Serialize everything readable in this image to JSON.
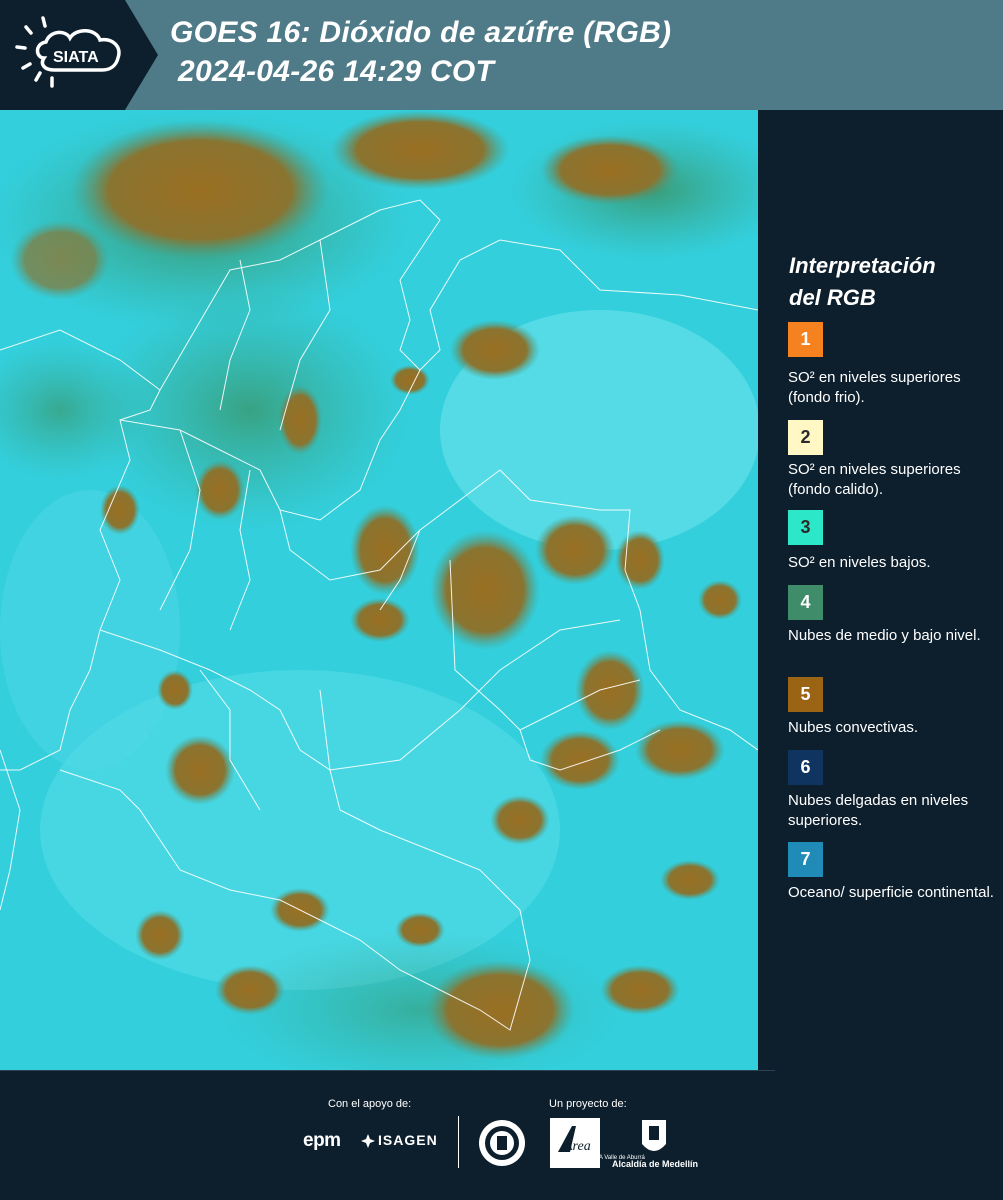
{
  "header": {
    "logo_text": "SIATA",
    "title_line1": "GOES 16: Dióxido de azúfre (RGB)",
    "title_line2": "2024-04-26 14:29 COT"
  },
  "legend": {
    "title_line1": "Interpretación",
    "title_line2": "del RGB",
    "items": [
      {
        "number": "1",
        "color": "#f5821f",
        "label": "SO² en niveles superiores (fondo frio)."
      },
      {
        "number": "2",
        "color": "#fff8c4",
        "label": "SO² en niveles superiores (fondo calido)."
      },
      {
        "number": "3",
        "color": "#2de8c8",
        "label": "SO² en niveles bajos."
      },
      {
        "number": "4",
        "color": "#3e8c6a",
        "label": "Nubes de medio y bajo nivel."
      },
      {
        "number": "5",
        "color": "#9b6314",
        "label": "Nubes convectivas."
      },
      {
        "number": "6",
        "color": "#0f3460",
        "label": "Nubes delgadas en niveles superiores."
      },
      {
        "number": "7",
        "color": "#1f8bb6",
        "label": "Oceano/ superficie continental."
      }
    ]
  },
  "footer": {
    "support_label": "Con el apoyo de:",
    "project_label": "Un proyecto de:",
    "epm_text": "epm",
    "isagen_text": "ISAGEN",
    "area_text": "Área",
    "area_subtext": "METROPOLITANA Valle de Aburrá",
    "alcaldia_text": "Alcaldía de Medellín"
  },
  "map_colors": {
    "background": "#2fd1df",
    "cloud": "#9a7a2a",
    "mid_cloud": "#2f9a6e",
    "border": "#ffffff"
  }
}
